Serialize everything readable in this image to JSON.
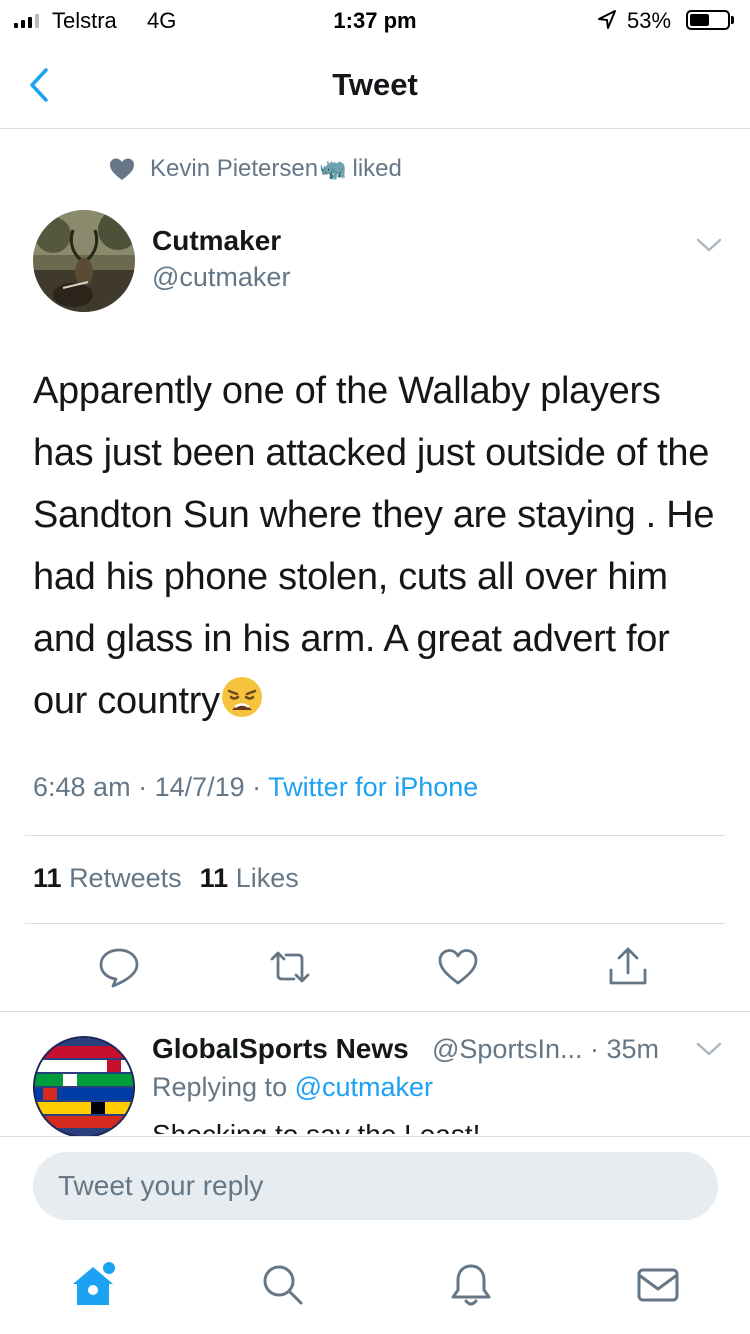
{
  "status_bar": {
    "carrier": "Telstra",
    "network": "4G",
    "time": "1:37 pm",
    "battery_percent": "53%",
    "battery_level": 0.53
  },
  "nav": {
    "back_icon": "chevron-left-icon",
    "title": "Tweet"
  },
  "context": {
    "liker_name": "Kevin Pietersen",
    "liker_emoji": "🦏",
    "action": "liked"
  },
  "tweet": {
    "author_name": "Cutmaker",
    "author_handle": "@cutmaker",
    "text": "Apparently one of the Wallaby players has just been attacked just outside of the Sandton Sun where they are staying . He had his phone stolen, cuts all over him and glass in his arm. A great advert for our country",
    "time": "6:48 am",
    "sep1": " · ",
    "date": "14/7/19",
    "sep2": " · ",
    "source": "Twitter for iPhone",
    "retweet_count": "11",
    "retweet_label": "Retweets",
    "like_count": "11",
    "like_label": "Likes"
  },
  "reply": {
    "author_name": "GlobalSports News",
    "author_handle": "@SportsIn... · 35m",
    "replying_prefix": "Replying to ",
    "replying_to": "@cutmaker",
    "text_partial": "Shocking to say the Least!"
  },
  "compose": {
    "placeholder": "Tweet your reply"
  },
  "tabbar": {
    "items": [
      "home-icon",
      "search-icon",
      "notifications-icon",
      "messages-icon"
    ]
  },
  "colors": {
    "accent": "#1da1f2",
    "secondary_text": "#657786",
    "divider": "#d8dde1"
  }
}
